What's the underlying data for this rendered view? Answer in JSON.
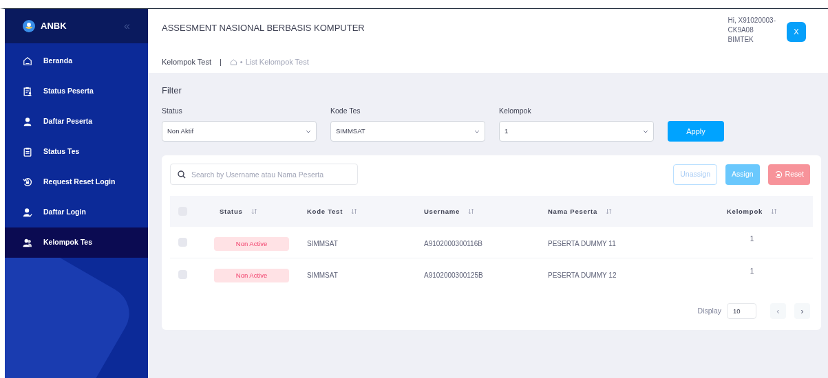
{
  "sidebar": {
    "brand": "ANBK",
    "collapse_icon": "«",
    "items": [
      {
        "label": "Beranda",
        "kind": "home",
        "selected": false
      },
      {
        "label": "Status Peserta",
        "kind": "clipboard-user",
        "selected": false
      },
      {
        "label": "Daftar Peserta",
        "kind": "user",
        "selected": false
      },
      {
        "label": "Status Tes",
        "kind": "clipboard",
        "selected": false
      },
      {
        "label": "Request Reset Login",
        "kind": "reset",
        "selected": false
      },
      {
        "label": "Daftar Login",
        "kind": "user-check",
        "selected": false
      },
      {
        "label": "Kelompok Tes",
        "kind": "users",
        "selected": true
      }
    ]
  },
  "header": {
    "title": "ASSESMENT NASIONAL BERBASIS KOMPUTER",
    "user_lines": [
      "Hi, X91020003-",
      "CK9A08",
      "BIMTEK"
    ],
    "user_button": "X",
    "breadcrumb": {
      "page": "Kelompok Test",
      "separator": "|",
      "dot": "•",
      "trail": "List Kelompok Test"
    }
  },
  "filter": {
    "title": "Filter",
    "fields": [
      {
        "label": "Status",
        "value": "Non Aktif"
      },
      {
        "label": "Kode Tes",
        "value": "SIMMSAT"
      },
      {
        "label": "Kelompok",
        "value": "1"
      }
    ],
    "apply": "Apply"
  },
  "table_panel": {
    "search": {
      "placeholder": "Search by Username atau Nama Peserta"
    },
    "actions": [
      {
        "label": "Unassign",
        "kind": "outline",
        "disabled": true
      },
      {
        "label": "Assign",
        "kind": "primary",
        "disabled": true
      },
      {
        "label": "Reset",
        "kind": "danger",
        "disabled": true
      }
    ],
    "select_all_checked": false,
    "columns": [
      "Status",
      "Kode Test",
      "Username",
      "Nama Peserta",
      "Kelompok"
    ],
    "rows": [
      {
        "checked": false,
        "status": "Non Active",
        "kode_test": "SIMMSAT",
        "username": "A9102000300116B",
        "nama": "PESERTA DUMMY 11",
        "kelompok": "1"
      },
      {
        "checked": false,
        "status": "Non Active",
        "kode_test": "SIMMSAT",
        "username": "A9102000300125B",
        "nama": "PESERTA DUMMY 12",
        "kelompok": "1"
      }
    ],
    "display_label": "Display",
    "display_value": "10",
    "prev": "‹",
    "next": "›"
  }
}
